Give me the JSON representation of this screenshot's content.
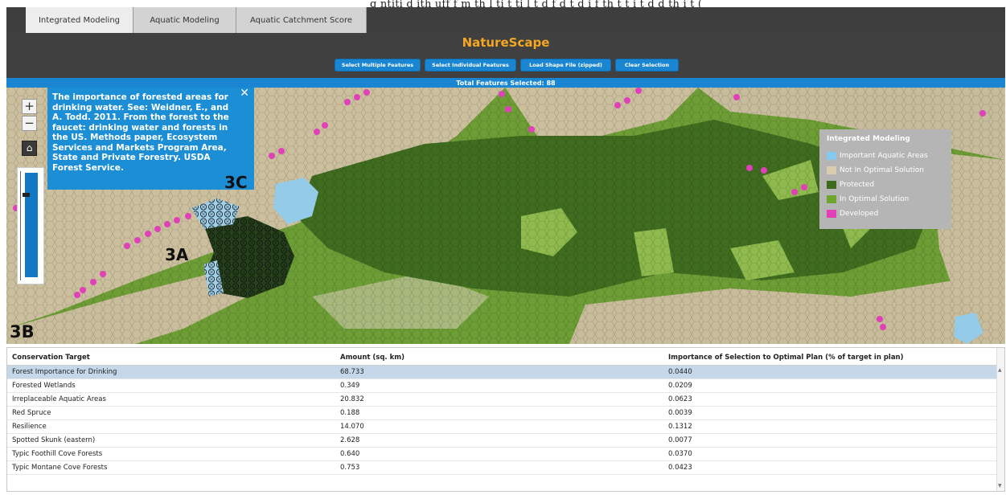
{
  "caption_fragment": "g  ntiti  d  ith  uff  f  m  th   l  ti  t  ti  l  t  d   f  d  t   d     i  f th   t  t  i  t   d   d  th  i  t      (",
  "tabs": [
    {
      "label": "Integrated Modeling",
      "active": true
    },
    {
      "label": "Aquatic Modeling",
      "active": false
    },
    {
      "label": "Aquatic Catchment Score",
      "active": false
    }
  ],
  "app": {
    "title": "NatureScape"
  },
  "toolbar": {
    "buttons": [
      "Select Multiple Features",
      "Select Individual Features",
      "Load Shape File (zipped)",
      "Clear Selection"
    ]
  },
  "status": {
    "total_selected": "Total Features Selected: 88"
  },
  "map": {
    "zoom_in": "+",
    "zoom_out": "−",
    "home_icon": "⌂",
    "popup": {
      "text": "The importance of forested areas for drinking water. See: Weidner, E., and A. Todd. 2011. From the forest to the faucet: drinking water and forests in the US. Methods paper, Ecosystem Services and Markets Program Area, State and Private Forestry. USDA Forest Service.",
      "close": "✕"
    },
    "labels": {
      "a": "3A",
      "b": "3B",
      "c": "3C"
    }
  },
  "legend": {
    "title": "Integrated Modeling",
    "items": [
      {
        "label": "Important Aquatic Areas",
        "color": "#86c9ee"
      },
      {
        "label": "Not In Optimal Solution",
        "color": "#d9cdb0"
      },
      {
        "label": "Protected",
        "color": "#3d6a1c"
      },
      {
        "label": "In Optimal Solution",
        "color": "#6ea52e"
      },
      {
        "label": "Developed",
        "color": "#e040b8"
      }
    ]
  },
  "table": {
    "headers": [
      "Conservation Target",
      "Amount (sq. km)",
      "Importance of Selection to Optimal Plan (% of target in plan)"
    ],
    "rows": [
      {
        "target": "Forest Importance for Drinking",
        "amount": "68.733",
        "importance": "0.0440",
        "selected": true
      },
      {
        "target": "Forested Wetlands",
        "amount": "0.349",
        "importance": "0.0209",
        "selected": false
      },
      {
        "target": "Irreplaceable Aquatic Areas",
        "amount": "20.832",
        "importance": "0.0623",
        "selected": false
      },
      {
        "target": "Red Spruce",
        "amount": "0.188",
        "importance": "0.0039",
        "selected": false
      },
      {
        "target": "Resilience",
        "amount": "14.070",
        "importance": "0.1312",
        "selected": false
      },
      {
        "target": "Spotted Skunk (eastern)",
        "amount": "2.628",
        "importance": "0.0077",
        "selected": false
      },
      {
        "target": "Typic Foothill Cove Forests",
        "amount": "0.640",
        "importance": "0.0370",
        "selected": false
      },
      {
        "target": "Typic Montane Cove Forests",
        "amount": "0.753",
        "importance": "0.0423",
        "selected": false
      }
    ]
  },
  "colors": {
    "accent": "#1a86d1",
    "title": "#f5a623",
    "header_bg": "#404040"
  }
}
